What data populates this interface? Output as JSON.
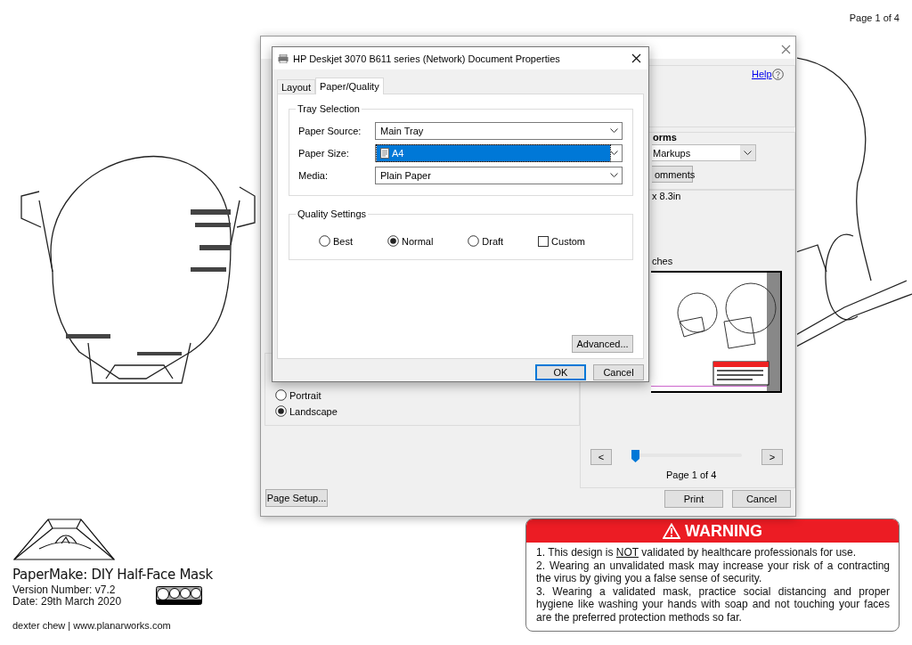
{
  "document": {
    "page_indicator": "Page 1 of 4",
    "title": "PaperMake: DIY Half-Face Mask",
    "version": "Version Number: v7.2",
    "date": "Date: 29th March 2020",
    "credit": "dexter chew | www.planarworks.com",
    "warning": {
      "heading": "WARNING",
      "items": [
        [
          {
            "text": "1. This design is "
          },
          {
            "text": "NOT",
            "underline": true
          },
          {
            "text": " validated by healthcare professionals for use."
          }
        ],
        [
          {
            "text": "2. Wearing an unvalidated mask may increase your risk of a contracting the virus by giving you a false sense of security."
          }
        ],
        [
          {
            "text": "3. Wearing a validated mask, practice social distancing and proper hygiene like washing your hands with soap and not touching your faces are the preferred protection methods so far."
          }
        ]
      ]
    }
  },
  "print_dialog": {
    "help_link": "Help",
    "section_heading_fragment": "orms",
    "content_dropdown": "Markups",
    "comments_button": "omments",
    "paper_size_fragment": "x 8.3in",
    "scale_fragment": "ches",
    "orientation": [
      {
        "label": "Portrait",
        "selected": false
      },
      {
        "label": "Landscape",
        "selected": true
      }
    ],
    "page_nav": {
      "prev": "<",
      "next": ">",
      "slider": {
        "level": 0
      },
      "page_label": "Page 1 of 4"
    },
    "page_setup_button": "Page Setup...",
    "buttons": [
      "Print",
      "Cancel"
    ]
  },
  "properties_dialog": {
    "title": "HP Deskjet 3070 B611 series (Network) Document Properties",
    "tabs": [
      {
        "label": "Layout",
        "selected": false
      },
      {
        "label": "Paper/Quality",
        "selected": true
      }
    ],
    "tray_selection": {
      "heading": "Tray Selection",
      "fields": [
        {
          "label": "Paper Source:",
          "value": "Main Tray",
          "selected": false
        },
        {
          "label": "Paper Size:",
          "value": "A4",
          "selected": true
        },
        {
          "label": "Media:",
          "value": "Plain Paper",
          "selected": false
        }
      ]
    },
    "quality_settings": {
      "heading": "Quality Settings",
      "options": [
        {
          "kind": "radio",
          "label": "Best",
          "selected": false
        },
        {
          "kind": "radio",
          "label": "Normal",
          "selected": true
        },
        {
          "kind": "radio",
          "label": "Draft",
          "selected": false
        },
        {
          "kind": "checkbox",
          "label": "Custom",
          "checked": false
        }
      ]
    },
    "advanced_button": "Advanced...",
    "buttons": [
      {
        "label": "OK",
        "default": true
      },
      {
        "label": "Cancel",
        "default": false
      }
    ]
  }
}
